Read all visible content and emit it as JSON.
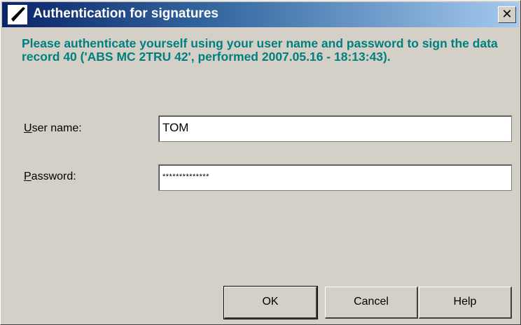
{
  "window": {
    "title": "Authentication for signatures",
    "close_glyph": "✕",
    "icon": "pen-signature-icon"
  },
  "message": "Please authenticate yourself using your user name and password to sign the data record 40 ('ABS MC 2TRU 42', performed 2007.05.16 - 18:13:43).",
  "form": {
    "user": {
      "label_accel": "U",
      "label_rest": "ser name:",
      "value": "TOM"
    },
    "password": {
      "label_accel": "P",
      "label_rest": "assword:",
      "masked_value": "**************"
    }
  },
  "buttons": {
    "ok": "OK",
    "cancel": "Cancel",
    "help": "Help"
  },
  "colors": {
    "title_gradient_start": "#0a246a",
    "title_gradient_end": "#a6caf0",
    "message_text": "#007f7f",
    "dialog_face": "#d4d0c8"
  }
}
